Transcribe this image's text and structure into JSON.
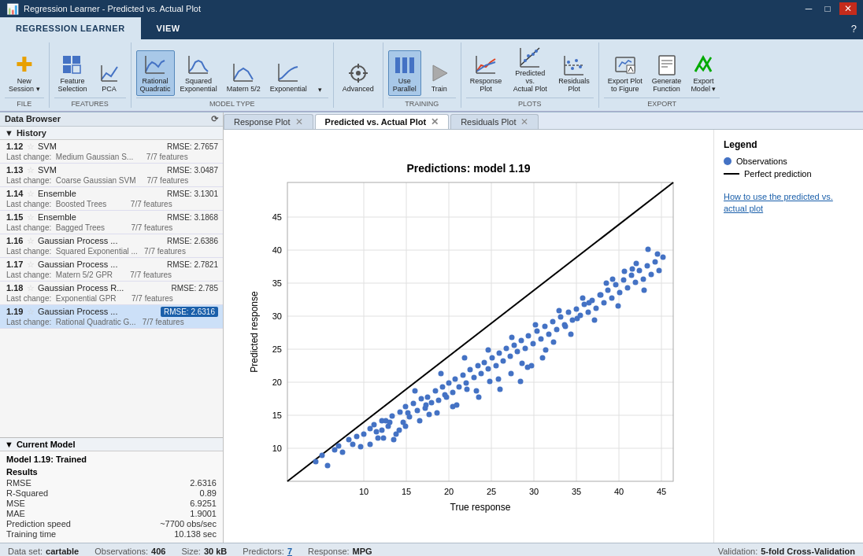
{
  "titleBar": {
    "title": "Regression Learner - Predicted vs. Actual Plot",
    "controls": [
      "minimize",
      "maximize",
      "close"
    ]
  },
  "ribbon": {
    "tabs": [
      {
        "id": "regression-learner",
        "label": "REGRESSION LEARNER",
        "active": true
      },
      {
        "id": "view",
        "label": "VIEW",
        "active": false
      }
    ],
    "groups": [
      {
        "id": "file",
        "label": "FILE",
        "buttons": [
          {
            "id": "new-session",
            "label": "New\nSession ▾",
            "icon": "➕"
          }
        ]
      },
      {
        "id": "features",
        "label": "FEATURES",
        "buttons": [
          {
            "id": "feature-selection",
            "label": "Feature\nSelection",
            "icon": "▦"
          },
          {
            "id": "pca",
            "label": "PCA",
            "icon": "📊"
          }
        ]
      },
      {
        "id": "model-type",
        "label": "MODEL TYPE",
        "buttons": [
          {
            "id": "rational-quadratic",
            "label": "Rational\nQuadratic",
            "icon": "📈",
            "active": true
          },
          {
            "id": "squared-exponential",
            "label": "Squared\nExponential",
            "icon": "📈"
          },
          {
            "id": "matern52",
            "label": "Matern 5/2",
            "icon": "📈"
          },
          {
            "id": "exponential",
            "label": "Exponential",
            "icon": "📈"
          }
        ]
      },
      {
        "id": "advanced-group",
        "buttons": [
          {
            "id": "advanced",
            "label": "Advanced",
            "icon": "⚙"
          }
        ]
      },
      {
        "id": "training",
        "label": "TRAINING",
        "buttons": [
          {
            "id": "use-parallel",
            "label": "Use\nParallel",
            "icon": "⬛",
            "active": true
          },
          {
            "id": "train",
            "label": "Train",
            "icon": "▶"
          }
        ]
      },
      {
        "id": "plots",
        "label": "PLOTS",
        "buttons": [
          {
            "id": "response-plot",
            "label": "Response\nPlot",
            "icon": "📉"
          },
          {
            "id": "predicted-actual-plot",
            "label": "Predicted vs.\nActual Plot",
            "icon": "📉"
          },
          {
            "id": "residuals-plot",
            "label": "Residuals\nPlot",
            "icon": "📉"
          }
        ]
      },
      {
        "id": "export",
        "label": "EXPORT",
        "buttons": [
          {
            "id": "export-plot-to-figure",
            "label": "Export Plot\nto Figure",
            "icon": "🖼"
          },
          {
            "id": "generate-function",
            "label": "Generate\nFunction",
            "icon": "📄"
          },
          {
            "id": "export-model",
            "label": "Export\nModel ▾",
            "icon": "✅"
          }
        ]
      }
    ]
  },
  "sidebar": {
    "dataBrowserLabel": "Data Browser",
    "historyLabel": "History",
    "historyItems": [
      {
        "num": "1.12",
        "type": "SVM",
        "rmse": "RMSE: 2.7657",
        "change": "Last change:  Medium Gaussian S...",
        "features": "7/7 features"
      },
      {
        "num": "1.13",
        "type": "SVM",
        "rmse": "RMSE: 3.0487",
        "change": "Last change:  Coarse Gaussian SVM",
        "features": "7/7 features"
      },
      {
        "num": "1.14",
        "type": "Ensemble",
        "rmse": "RMSE: 3.1301",
        "change": "Last change:  Boosted Trees",
        "features": "7/7 features"
      },
      {
        "num": "1.15",
        "type": "Ensemble",
        "rmse": "RMSE: 3.1868",
        "change": "Last change:  Bagged Trees",
        "features": "7/7 features"
      },
      {
        "num": "1.16",
        "type": "Gaussian Process ...",
        "rmse": "RMSE: 2.6386",
        "change": "Last change:  Squared Exponential ...",
        "features": "7/7 features"
      },
      {
        "num": "1.17",
        "type": "Gaussian Process ...",
        "rmse": "RMSE: 2.7821",
        "change": "Last change:  Matern 5/2 GPR",
        "features": "7/7 features"
      },
      {
        "num": "1.18",
        "type": "Gaussian Process R...",
        "rmse": "RMSE: 2.785",
        "change": "Last change:  Exponential GPR",
        "features": "7/7 features"
      },
      {
        "num": "1.19",
        "type": "Gaussian Process ...",
        "rmse": "RMSE: 2.6316",
        "change": "Last change:  Rational Quadratic G...",
        "features": "7/7 features",
        "selected": true
      }
    ],
    "currentModelLabel": "Current Model",
    "currentModel": {
      "title": "Model 1.19: Trained",
      "resultsLabel": "Results",
      "results": [
        {
          "label": "RMSE",
          "value": "2.6316"
        },
        {
          "label": "R-Squared",
          "value": "0.89"
        },
        {
          "label": "MSE",
          "value": "6.9251"
        },
        {
          "label": "MAE",
          "value": "1.9001"
        },
        {
          "label": "Prediction speed",
          "value": "~7700 obs/sec"
        },
        {
          "label": "Training time",
          "value": "10.138 sec"
        }
      ]
    }
  },
  "contentTabs": [
    {
      "id": "response-plot",
      "label": "Response Plot",
      "closeable": true
    },
    {
      "id": "predicted-actual-plot",
      "label": "Predicted vs. Actual Plot",
      "closeable": true,
      "active": true
    },
    {
      "id": "residuals-plot",
      "label": "Residuals Plot",
      "closeable": true
    }
  ],
  "plot": {
    "title": "Predictions: model 1.19",
    "xLabel": "True response",
    "yLabel": "Predicted response",
    "xMin": 5,
    "xMax": 50,
    "yMin": 5,
    "yMax": 50
  },
  "legend": {
    "title": "Legend",
    "items": [
      {
        "type": "dot",
        "label": "Observations"
      },
      {
        "type": "line",
        "label": "Perfect prediction"
      }
    ],
    "helpText": "How to use the predicted vs. actual plot"
  },
  "statusBar": {
    "dataset": {
      "label": "Data set:",
      "value": "cartable"
    },
    "observations": {
      "label": "Observations:",
      "value": "406"
    },
    "size": {
      "label": "Size:",
      "value": "30 kB"
    },
    "predictors": {
      "label": "Predictors:",
      "value": "7"
    },
    "response": {
      "label": "Response:",
      "value": "MPG"
    },
    "validation": {
      "label": "Validation:",
      "value": "5-fold Cross-Validation"
    }
  }
}
